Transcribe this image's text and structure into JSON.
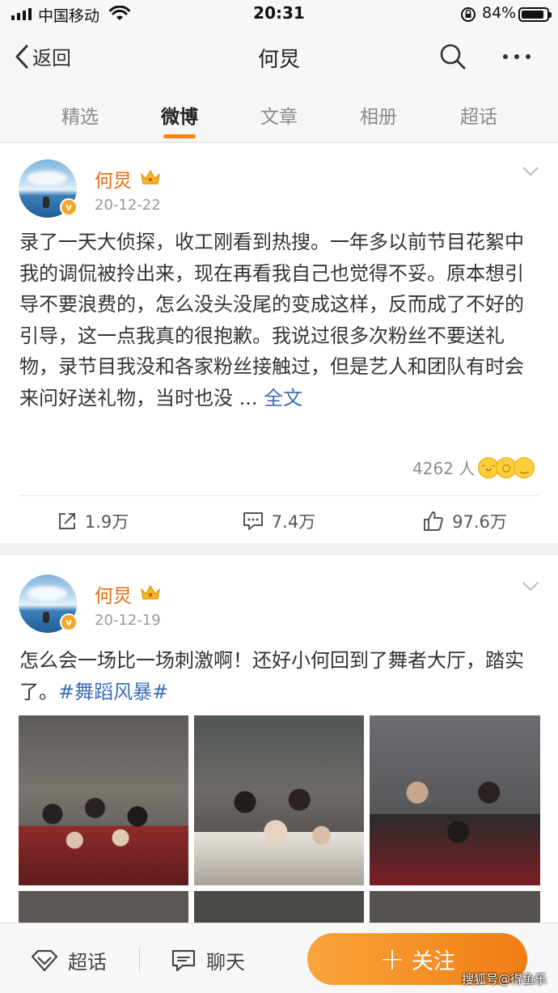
{
  "status_bar": {
    "carrier": "中国移动",
    "time": "20:31",
    "battery": "84%"
  },
  "nav": {
    "back_label": "返回",
    "title": "何炅"
  },
  "tabs": [
    {
      "label": "精选",
      "active": false
    },
    {
      "label": "微博",
      "active": true
    },
    {
      "label": "文章",
      "active": false
    },
    {
      "label": "相册",
      "active": false
    },
    {
      "label": "超话",
      "active": false
    }
  ],
  "posts": [
    {
      "author": "何炅",
      "date": "20-12-22",
      "text": "录了一天大侦探，收工刚看到热搜。一年多以前节目花絮中我的调侃被拎出来，现在再看我自己也觉得不妥。原本想引导不要浪费的，怎么没头没尾的变成这样，反而成了不好的引导，这一点我真的很抱歉。我说过很多次粉丝不要送礼物，录节目我没和各家粉丝接触过，但是艺人和团队有时会来问好送礼物，当时也没 ...",
      "more_label": "全文",
      "reaction_count": "4262 人",
      "reposts": "1.9万",
      "comments": "7.4万",
      "likes": "97.6万"
    },
    {
      "author": "何炅",
      "date": "20-12-19",
      "text": "怎么会一场比一场刺激啊！还好小何回到了舞者大厅，踏实了。",
      "hashtag": "#舞蹈风暴#"
    }
  ],
  "bottom_bar": {
    "topic_label": "超话",
    "chat_label": "聊天",
    "follow_label": "关注"
  },
  "watermark": "搜狐号@得鱼乐",
  "colors": {
    "accent": "#ff8200",
    "username": "#e86b0b",
    "link": "#3c6fb4"
  }
}
